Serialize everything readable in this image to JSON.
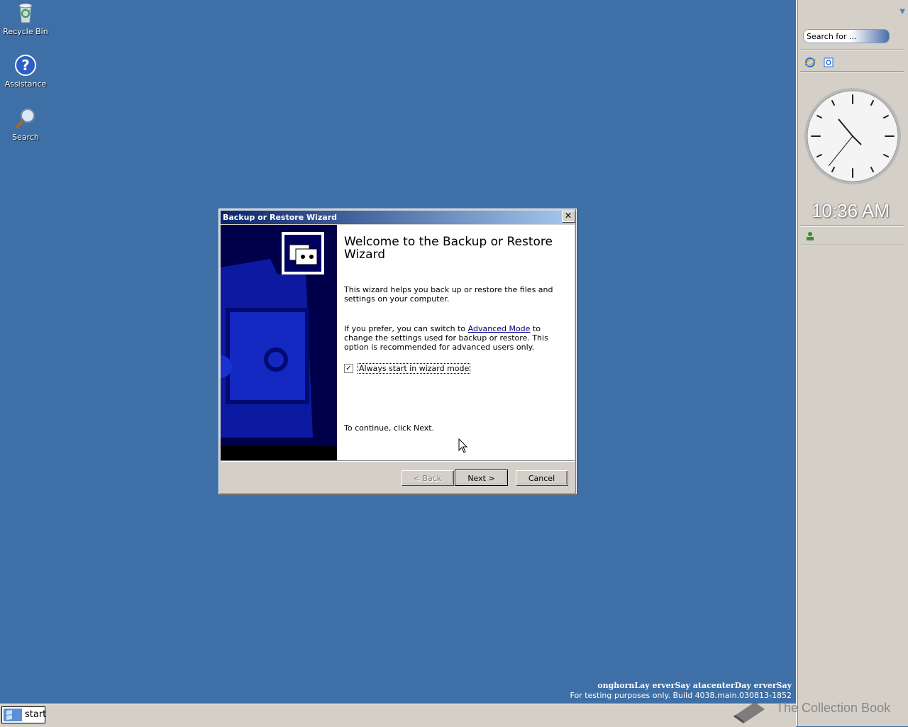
{
  "desktop": {
    "icons": [
      {
        "label": "Recycle Bin"
      },
      {
        "label": "Assistance"
      },
      {
        "label": "Search"
      }
    ]
  },
  "sidebar": {
    "search_text": "Search for ...",
    "clock_time": "10:36 AM"
  },
  "dialog": {
    "title": "Backup or Restore Wizard",
    "heading": "Welcome to the Backup or Restore Wizard",
    "intro": "This wizard helps you back up or restore the files and settings on your computer.",
    "prefer_text_before": "If you prefer, you can switch to ",
    "advanced_link": "Advanced Mode",
    "prefer_text_after": " to change the settings used for backup or restore. This option is recommended for advanced users only.",
    "checkbox_label": "Always start in wizard mode",
    "checkbox_checked": true,
    "continue_text": "To continue, click Next.",
    "buttons": {
      "back": "< Back",
      "next": "Next >",
      "cancel": "Cancel"
    }
  },
  "taskbar": {
    "start_label": "start"
  },
  "watermark": {
    "line1": "onghornLay erverSay atacenterDay erverSay",
    "line2": "For testing purposes only. Build 4038.main.030813-1852"
  },
  "brand": {
    "text": "The Collection Book"
  }
}
